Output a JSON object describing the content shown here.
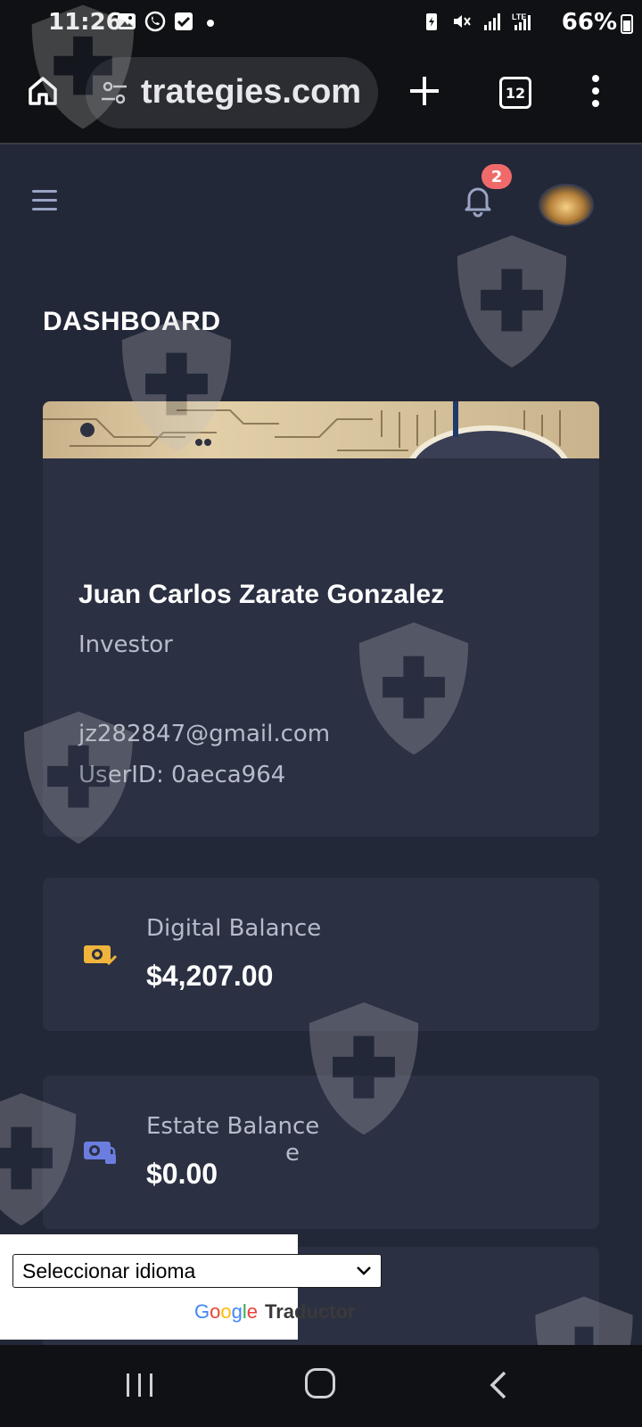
{
  "status_bar": {
    "time": "11:26",
    "battery": "66%",
    "network": "LTE",
    "icons": [
      "gallery-icon",
      "whatsapp-icon",
      "check-box-icon",
      "battery-saver-icon",
      "mute-icon",
      "signal-icon",
      "lte-signal-icon"
    ]
  },
  "browser": {
    "url": "trategies.com",
    "tab_count": "12"
  },
  "header": {
    "notification_count": "2"
  },
  "page": {
    "title": "DASHBOARD"
  },
  "profile": {
    "name": "Juan Carlos Zarate Gonzalez",
    "role": "Investor",
    "email": "jz282847@gmail.com",
    "user_id": "UserID: 0aeca964"
  },
  "balances": [
    {
      "label": "Digital Balance",
      "value": "$4,207.00",
      "icon": "money-check-icon",
      "color": "#f0b43c"
    },
    {
      "label": "Estate Balance",
      "value": "$0.00",
      "icon": "money-lock-icon",
      "color": "#6b7ee0"
    }
  ],
  "partial_card_text": "e",
  "translate": {
    "select_label": "Seleccionar idioma",
    "powered_by_g": "G",
    "powered_by_o1": "o",
    "powered_by_o2": "o",
    "powered_by_g2": "g",
    "powered_by_l": "l",
    "powered_by_e": "e",
    "product": "Traductor"
  },
  "colors": {
    "page_bg": "#232838",
    "card_bg": "#2b3043",
    "badge": "#f16a6a",
    "accent_gold": "#f0b43c",
    "accent_blue": "#6b7ee0"
  }
}
